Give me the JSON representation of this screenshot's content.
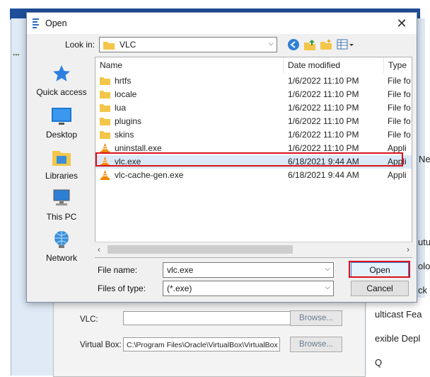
{
  "dialog": {
    "title": "Open",
    "look_in_label": "Look in:",
    "look_in_value": "VLC"
  },
  "places": [
    {
      "label": "Quick access",
      "icon": "star-icon"
    },
    {
      "label": "Desktop",
      "icon": "desktop-icon"
    },
    {
      "label": "Libraries",
      "icon": "libraries-icon"
    },
    {
      "label": "This PC",
      "icon": "computer-icon"
    },
    {
      "label": "Network",
      "icon": "network-icon"
    }
  ],
  "columns": [
    "Name",
    "Date modified",
    "Type"
  ],
  "files": [
    {
      "name": "hrtfs",
      "date": "1/6/2022 11:10 PM",
      "type": "File fo",
      "kind": "folder"
    },
    {
      "name": "locale",
      "date": "1/6/2022 11:10 PM",
      "type": "File fo",
      "kind": "folder"
    },
    {
      "name": "lua",
      "date": "1/6/2022 11:10 PM",
      "type": "File fo",
      "kind": "folder"
    },
    {
      "name": "plugins",
      "date": "1/6/2022 11:10 PM",
      "type": "File fo",
      "kind": "folder"
    },
    {
      "name": "skins",
      "date": "1/6/2022 11:10 PM",
      "type": "File fo",
      "kind": "folder"
    },
    {
      "name": "uninstall.exe",
      "date": "1/6/2022 11:10 PM",
      "type": "Appli",
      "kind": "vlc"
    },
    {
      "name": "vlc.exe",
      "date": "6/18/2021 9:44 AM",
      "type": "Appli",
      "kind": "vlc"
    },
    {
      "name": "vlc-cache-gen.exe",
      "date": "6/18/2021 9:44 AM",
      "type": "Appli",
      "kind": "vlc"
    }
  ],
  "form": {
    "file_name_label": "File name:",
    "file_name_value": "vlc.exe",
    "files_of_type_label": "Files of type:",
    "files_of_type_value": "(*.exe)",
    "open_label": "Open",
    "cancel_label": "Cancel"
  },
  "background": {
    "vlc_label": "VLC:",
    "vlc_value": "",
    "vbox_label": "Virtual Box:",
    "vbox_value": "C:\\Program Files\\Oracle\\VirtualBox\\VirtualBox",
    "browse_label": "Browse...",
    "side_texts": [
      "Ne",
      "utu",
      "olo",
      "ck",
      "ulticast Fea",
      "exible Depl",
      "Q"
    ]
  },
  "colors": {
    "highlight_outline": "#d8121b",
    "selection": "#dbe9f9",
    "folder": "#f3c64a",
    "vlc_orange": "#f08a00"
  }
}
